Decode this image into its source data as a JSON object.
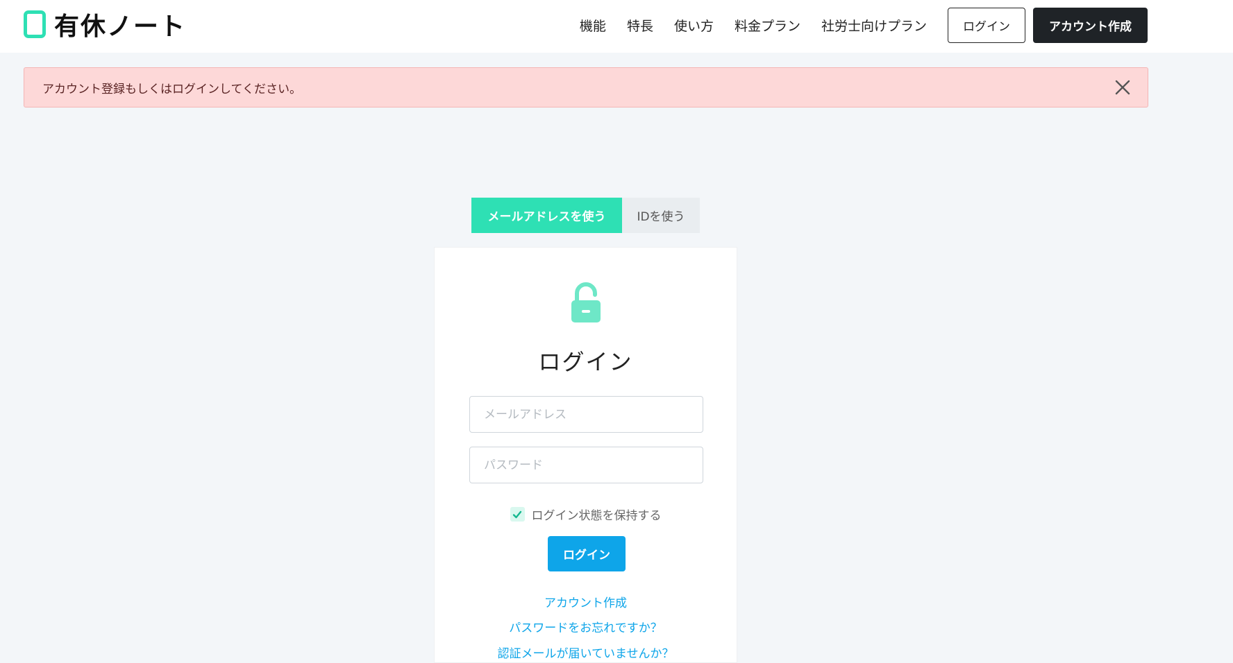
{
  "header": {
    "logo_text": "有休ノート",
    "nav": [
      "機能",
      "特長",
      "使い方",
      "料金プラン",
      "社労士向けプラン"
    ],
    "login_label": "ログイン",
    "signup_label": "アカウント作成"
  },
  "alert": {
    "message": "アカウント登録もしくはログインしてください。"
  },
  "tabs": {
    "email_label": "メールアドレスを使う",
    "id_label": "IDを使う"
  },
  "login_card": {
    "title": "ログイン",
    "email_placeholder": "メールアドレス",
    "password_placeholder": "パスワード",
    "remember_label": "ログイン状態を保持する",
    "remember_checked": true,
    "submit_label": "ログイン",
    "links": [
      "アカウント作成",
      "パスワードをお忘れですか？",
      "認証メールが届いていませんか？"
    ]
  },
  "colors": {
    "accent": "#2ee0b4",
    "primary_button": "#0ea5e9",
    "alert_bg": "#fdd8d8",
    "dark_button": "#1f2327"
  }
}
